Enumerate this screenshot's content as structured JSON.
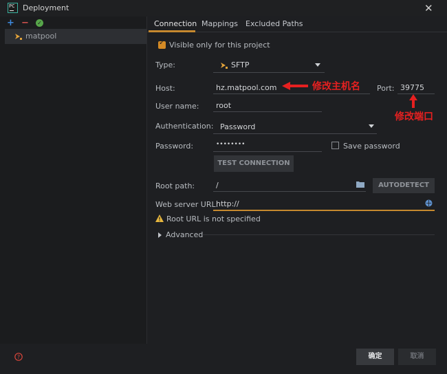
{
  "window": {
    "title": "Deployment",
    "app_icon_text": "PC"
  },
  "sidebar": {
    "servers": [
      {
        "name": "matpool"
      }
    ]
  },
  "tabs": [
    {
      "label": "Connection"
    },
    {
      "label": "Mappings"
    },
    {
      "label": "Excluded Paths"
    }
  ],
  "connection": {
    "visible_only_label": "Visible only for this project",
    "visible_only_checked": true,
    "type_label": "Type:",
    "type_value": "SFTP",
    "host_label": "Host:",
    "host_value": "hz.matpool.com",
    "port_label": "Port:",
    "port_value": "39775",
    "username_label": "User name:",
    "username_value": "root",
    "auth_label": "Authentication:",
    "auth_value": "Password",
    "password_label": "Password:",
    "password_value": "••••••••",
    "save_password_label": "Save password",
    "save_password_checked": false,
    "test_button": "TEST CONNECTION",
    "root_path_label": "Root path:",
    "root_path_value": "/",
    "autodetect_button": "AUTODETECT",
    "web_url_label": "Web server URL:",
    "web_url_value": "http://",
    "warning_text": "Root URL is not specified",
    "advanced_label": "Advanced"
  },
  "annotations": {
    "host_note": "修改主机名",
    "port_note": "修改端口"
  },
  "footer": {
    "ok_label": "确定",
    "cancel_label": "取消"
  },
  "colors": {
    "accent": "#c6892f",
    "annotation_red": "#e62020",
    "background": "#1e1f22"
  }
}
